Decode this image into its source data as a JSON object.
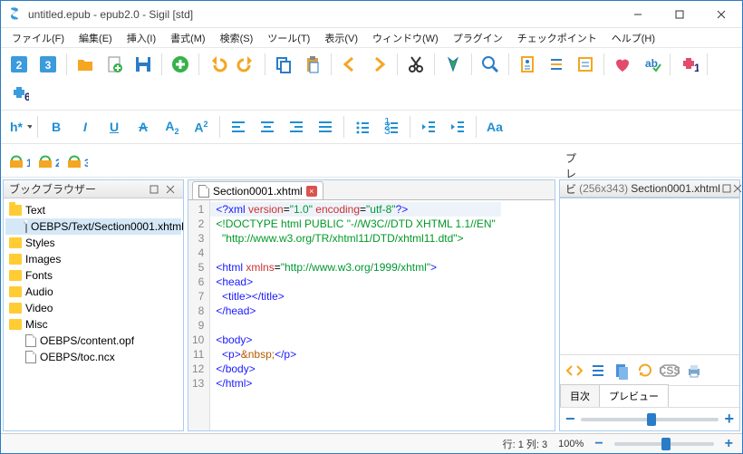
{
  "title": "untitled.epub - epub2.0 - Sigil [std]",
  "menus": [
    "ファイル(F)",
    "編集(E)",
    "挿入(I)",
    "書式(M)",
    "検索(S)",
    "ツール(T)",
    "表示(V)",
    "ウィンドウ(W)",
    "プラグイン",
    "チェックポイント",
    "ヘルプ(H)"
  ],
  "browser": {
    "title": "ブックブラウザー",
    "items": [
      {
        "type": "folder-open",
        "label": "Text",
        "indent": 0,
        "sel": false
      },
      {
        "type": "file",
        "label": "OEBPS/Text/Section0001.xhtml",
        "indent": 1,
        "sel": true
      },
      {
        "type": "folder",
        "label": "Styles",
        "indent": 0
      },
      {
        "type": "folder",
        "label": "Images",
        "indent": 0
      },
      {
        "type": "folder",
        "label": "Fonts",
        "indent": 0
      },
      {
        "type": "folder",
        "label": "Audio",
        "indent": 0
      },
      {
        "type": "folder",
        "label": "Video",
        "indent": 0
      },
      {
        "type": "folder",
        "label": "Misc",
        "indent": 0
      },
      {
        "type": "file",
        "label": "OEBPS/content.opf",
        "indent": 1
      },
      {
        "type": "file",
        "label": "OEBPS/toc.ncx",
        "indent": 1
      }
    ]
  },
  "editor": {
    "tab": "Section0001.xhtml",
    "lines": 13
  },
  "preview": {
    "title": "プレビュー",
    "dims": "(256x343)",
    "file": "Section0001.xhtml",
    "tabs": [
      "目次",
      "プレビュー"
    ],
    "activeTab": 1
  },
  "status": {
    "pos": "行: 1 列: 3",
    "zoom": "100%"
  }
}
